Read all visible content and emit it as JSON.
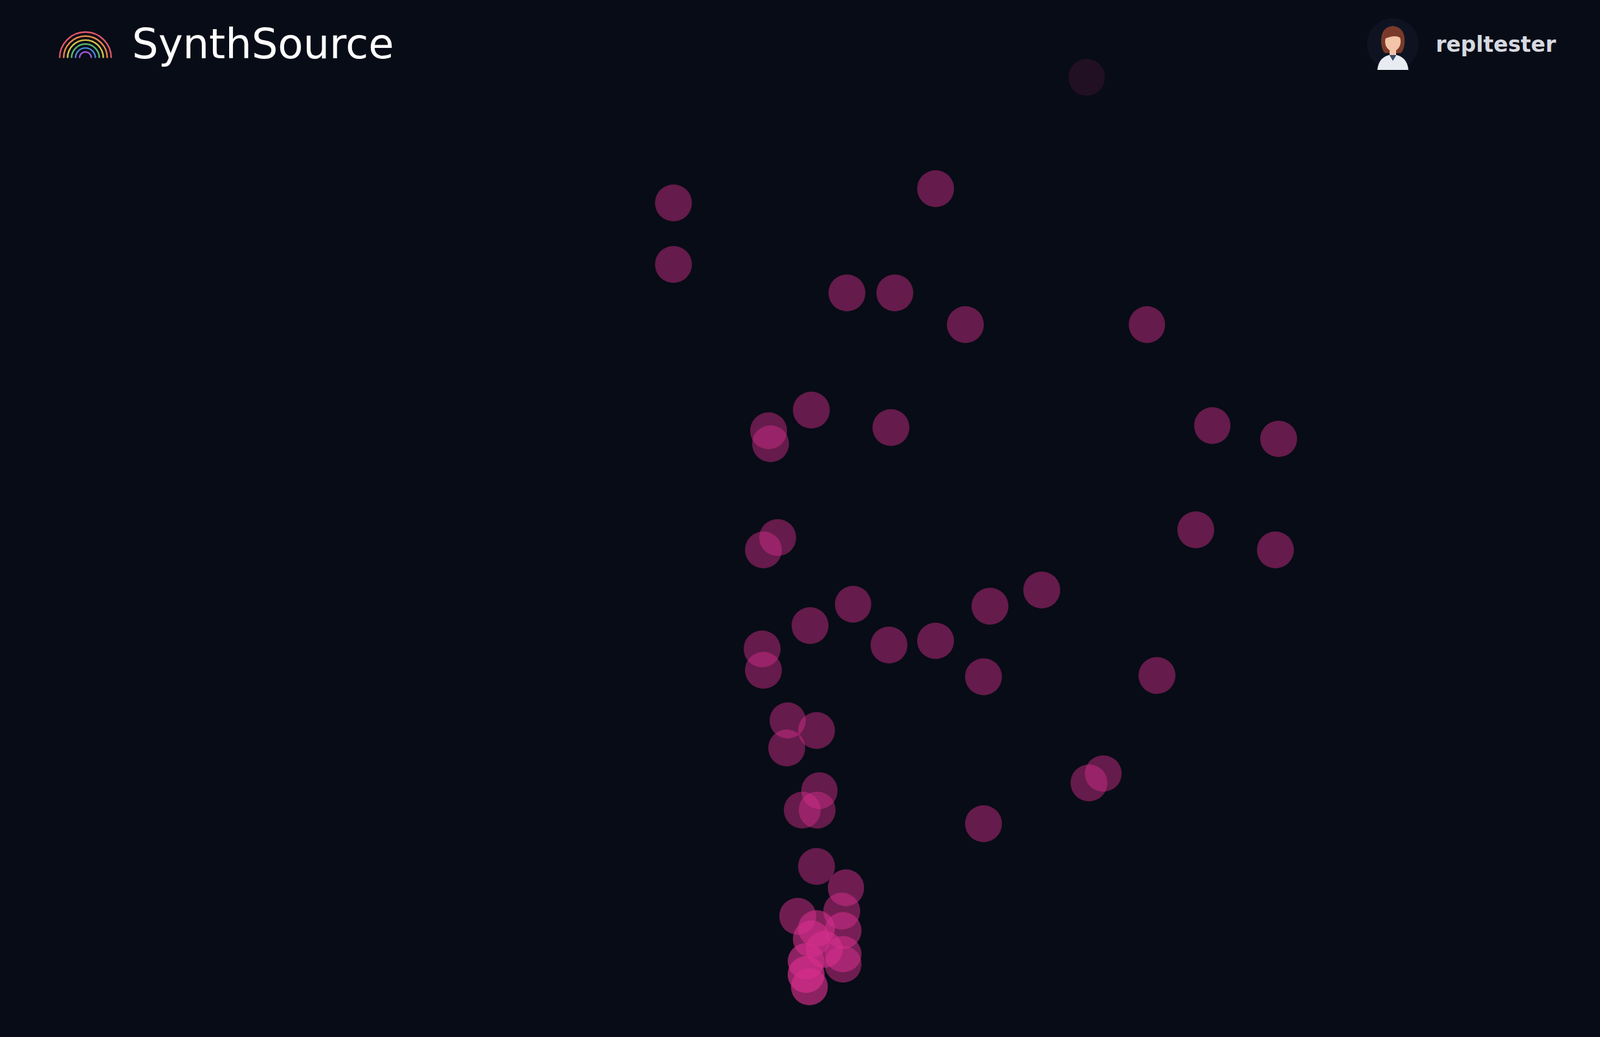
{
  "header": {
    "brand": "SynthSource",
    "user": {
      "name": "repltester"
    }
  }
}
